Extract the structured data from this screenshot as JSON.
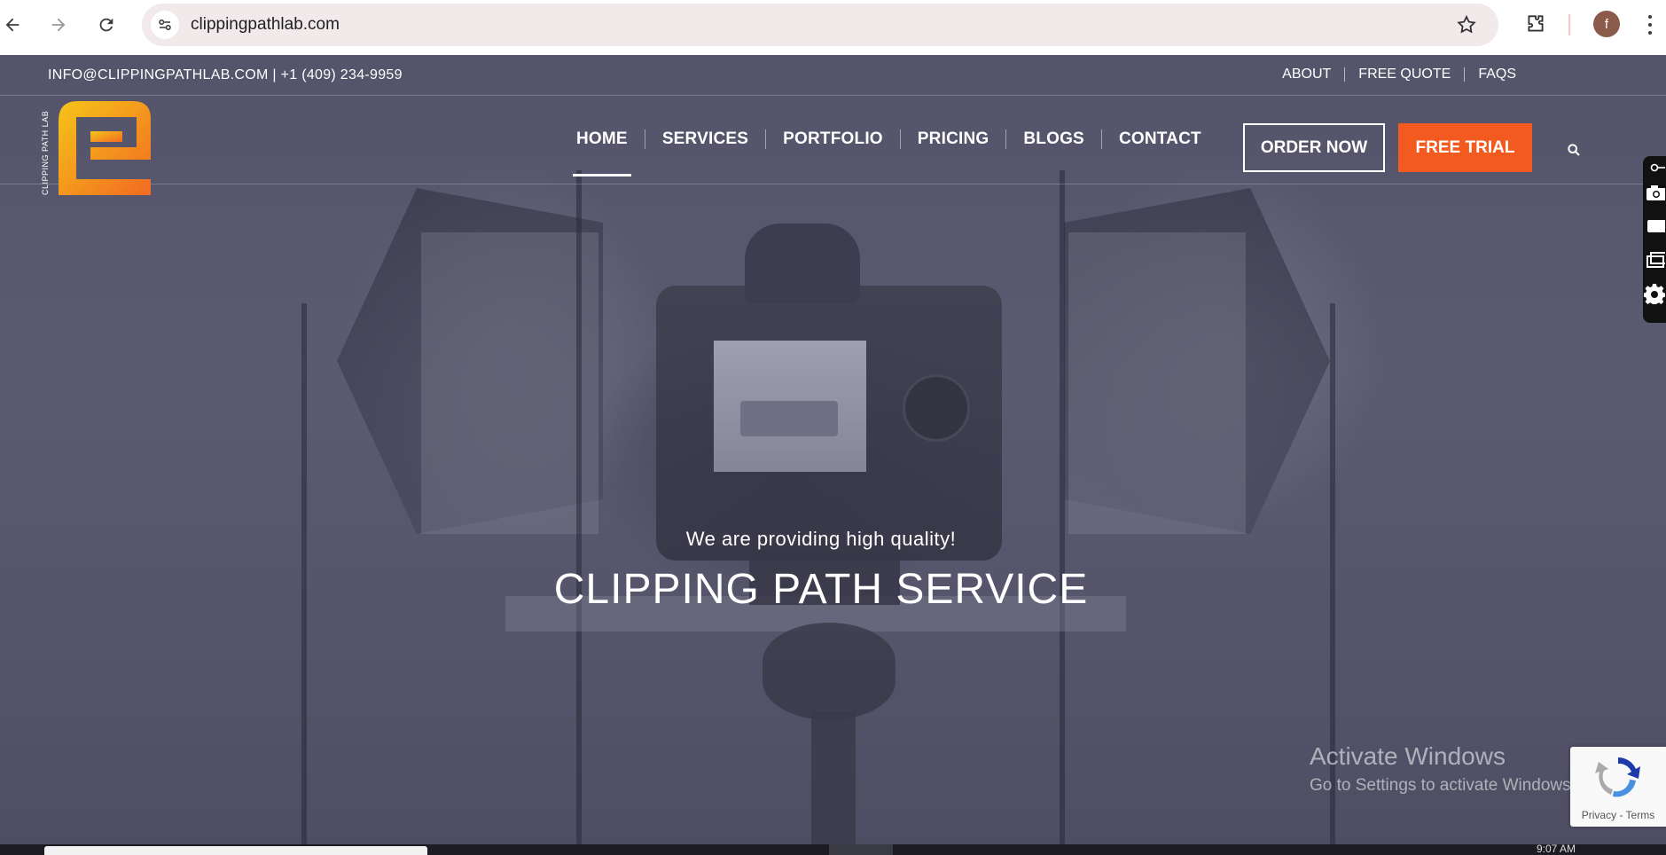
{
  "browser": {
    "url": "clippingpathlab.com",
    "profile_initial": "f",
    "icons": {
      "back": "back-arrow-icon",
      "forward": "forward-arrow-icon",
      "reload": "reload-icon",
      "site_settings": "site-settings-icon",
      "bookmark": "star-icon",
      "extensions": "puzzle-icon",
      "menu": "kebab-menu-icon"
    }
  },
  "topbar": {
    "contact": "INFO@CLIPPINGPATHLAB.COM | +1 (409) 234-9959",
    "links": [
      "ABOUT",
      "FREE QUOTE",
      "FAQS"
    ]
  },
  "logo": {
    "vertical_text": "CLIPPING PATH LAB",
    "colors": {
      "start": "#f5c518",
      "end": "#f26a22"
    }
  },
  "nav": {
    "items": [
      "HOME",
      "SERVICES",
      "PORTFOLIO",
      "PRICING",
      "BLOGS",
      "CONTACT"
    ],
    "active": "HOME",
    "order_now": "ORDER NOW",
    "free_trial": "FREE TRIAL",
    "accent_color": "#f25a1f"
  },
  "hero": {
    "tagline": "We are providing high quality!",
    "headline": "CLIPPING PATH SERVICE"
  },
  "watermark": {
    "title": "Activate Windows",
    "subtitle": "Go to Settings to activate Windows."
  },
  "recaptcha": {
    "terms": "Privacy - Terms"
  },
  "taskbar": {
    "clock": "9:07 AM"
  }
}
